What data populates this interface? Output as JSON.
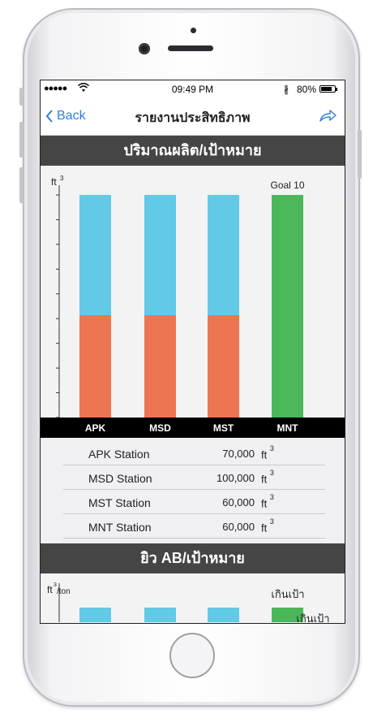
{
  "status": {
    "time": "09:49 PM",
    "battery": "80%",
    "battery_level": 0.8
  },
  "nav": {
    "back_label": "Back",
    "title": "รายงานประสิทธิภาพ"
  },
  "section1": {
    "title": "ปริมาณผลิต/เป้าหมาย",
    "chart_data": {
      "type": "bar",
      "y_unit": "ft",
      "y_unit_exp": "3",
      "categories": [
        "APK",
        "MSD",
        "MST",
        "MNT"
      ],
      "series": [
        {
          "values": [
            0.46,
            0.46,
            0.46,
            0
          ],
          "color": "#ee7552"
        },
        {
          "values": [
            0.54,
            0.54,
            0.54,
            0
          ],
          "color": "#62c9e6"
        },
        {
          "values": [
            0,
            0,
            0,
            1.0
          ],
          "color": "#4cb759"
        }
      ],
      "annotation": "Goal 10",
      "annotation_category": "MNT"
    },
    "rows": [
      {
        "name": "APK Station",
        "value": "70,000",
        "unit": "ft",
        "exp": "3"
      },
      {
        "name": "MSD Station",
        "value": "100,000",
        "unit": "ft",
        "exp": "3"
      },
      {
        "name": "MST Station",
        "value": "60,000",
        "unit": "ft",
        "exp": "3"
      },
      {
        "name": "MNT Station",
        "value": "60,000",
        "unit": "ft",
        "exp": "3"
      }
    ]
  },
  "section2": {
    "title": "ยิว AB/เป้าหมาย",
    "y_unit": "ft",
    "y_unit_exp": "3",
    "y_unit_suffix": "/ton",
    "over_label": "เกินเป้า",
    "over_label2": "เกินเป้า",
    "colors": {
      "blue": "#62c9e6",
      "green": "#4cb759"
    }
  }
}
